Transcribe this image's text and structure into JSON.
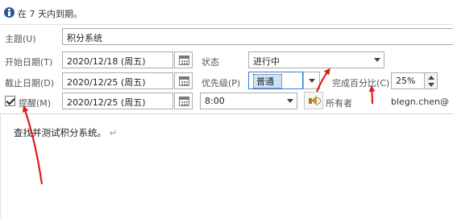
{
  "info_bar": {
    "icon": "info-icon",
    "text": "在 7 天内到期。"
  },
  "subject": {
    "label": "主题(U)",
    "value": "积分系统"
  },
  "start_date": {
    "label": "开始日期(T)",
    "value": "2020/12/18 (周五)"
  },
  "due_date": {
    "label": "截止日期(D)",
    "value": "2020/12/25 (周五)"
  },
  "reminder": {
    "label": "提醒(M)",
    "checked": true,
    "date": "2020/12/25 (周五)",
    "time": "8:00"
  },
  "status": {
    "label": "状态",
    "value": "进行中"
  },
  "priority": {
    "label": "优先级(P)",
    "value": "普通"
  },
  "percent_complete": {
    "label": "完成百分比(C)",
    "value": "25%"
  },
  "owner": {
    "label": "所有者",
    "value": "blegn.chen@"
  },
  "body": {
    "text": "查找并测试积分系统。",
    "mark": "↵"
  },
  "annotation": {
    "arrow_color": "#e01b1b"
  },
  "colors": {
    "accent": "#2b579a",
    "selected_fill": "#cde2f7",
    "selected_border": "#2f7ed8"
  }
}
